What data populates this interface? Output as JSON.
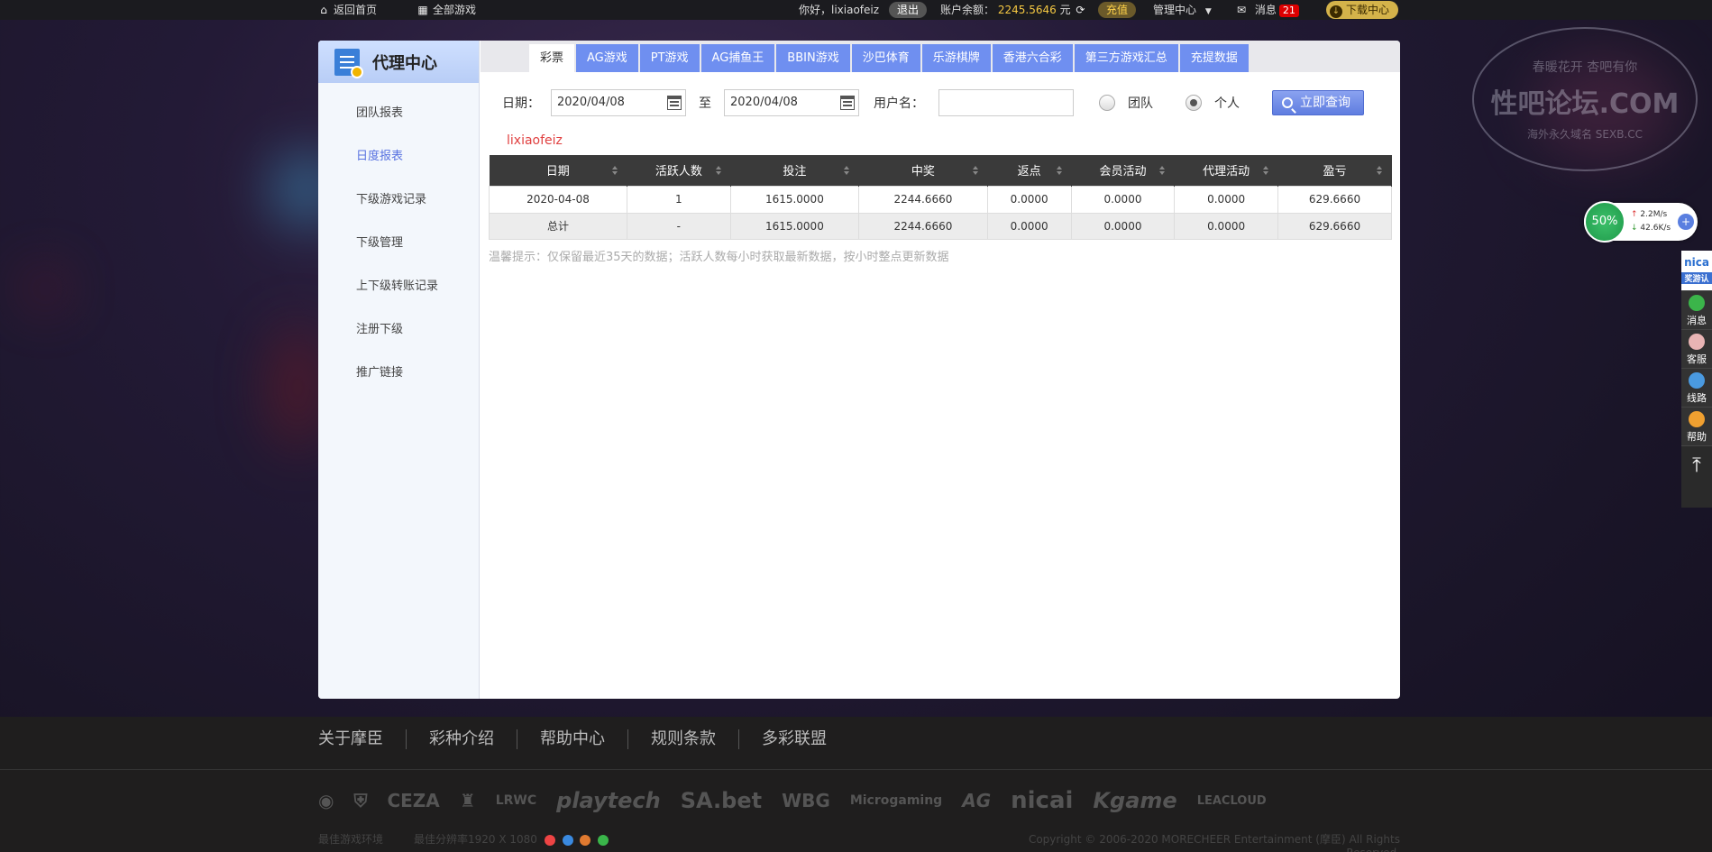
{
  "topbar": {
    "home": "返回首页",
    "all_games": "全部游戏",
    "greeting": "你好，lixiaofeiz",
    "logout": "退出",
    "balance_label": "账户余额：",
    "balance_value": "2245.5646",
    "balance_unit": "元",
    "recharge": "充值",
    "admin": "管理中心",
    "messages": "消息",
    "message_count": "21",
    "download": "下载中心"
  },
  "sidebar": {
    "title": "代理中心",
    "items": [
      "团队报表",
      "日度报表",
      "下级游戏记录",
      "下级管理",
      "上下级转账记录",
      "注册下级",
      "推广链接"
    ],
    "active_index": 1
  },
  "tabs": [
    "彩票",
    "AG游戏",
    "PT游戏",
    "AG捕鱼王",
    "BBIN游戏",
    "沙巴体育",
    "乐游棋牌",
    "香港六合彩",
    "第三方游戏汇总",
    "充提数据"
  ],
  "filter": {
    "date_label": "日期：",
    "date_from": "2020/04/08",
    "to": "至",
    "date_to": "2020/04/08",
    "username_label": "用户名：",
    "username_value": "",
    "team": "团队",
    "personal": "个人",
    "search": "立即查询"
  },
  "current_user": "lixiaofeiz",
  "table": {
    "headers": [
      "日期",
      "活跃人数",
      "投注",
      "中奖",
      "返点",
      "会员活动",
      "代理活动",
      "盈亏"
    ],
    "rows": [
      [
        "2020-04-08",
        "1",
        "1615.0000",
        "2244.6660",
        "0.0000",
        "0.0000",
        "0.0000",
        "629.6660"
      ]
    ],
    "total": [
      "总计",
      "-",
      "1615.0000",
      "2244.6660",
      "0.0000",
      "0.0000",
      "0.0000",
      "629.6660"
    ]
  },
  "tip": "温馨提示：仅保留最近35天的数据；活跃人数每小时获取最新数据，按小时整点更新数据",
  "footer": {
    "links": [
      "关于摩臣",
      "彩种介绍",
      "帮助中心",
      "规则条款",
      "多彩联盟"
    ],
    "logos": [
      "CEZA",
      "LRWC",
      "playtech",
      "SA.bet",
      "WBG",
      "Microgaming",
      "AG",
      "nicai",
      "Kgame",
      "LEACLOUD"
    ],
    "env": "最佳游戏环境",
    "resolution": "最佳分辨率1920 X 1080",
    "copyright": "Copyright © 2006-2020 MORECHEER Entertainment (摩臣) All Rights Reserved."
  },
  "speed_widget": {
    "percent": "50%",
    "up": "2.2M/s",
    "down": "42.6K/s"
  },
  "side_float": {
    "brand": "nica",
    "brand_sub": "奖游认",
    "items": [
      "消息",
      "客服",
      "线路",
      "帮助"
    ]
  },
  "watermark": {
    "line1": "春暖花开 杏吧有你",
    "line2": "性吧论坛.COM",
    "line3": "海外永久域名 SEXB.CC"
  }
}
